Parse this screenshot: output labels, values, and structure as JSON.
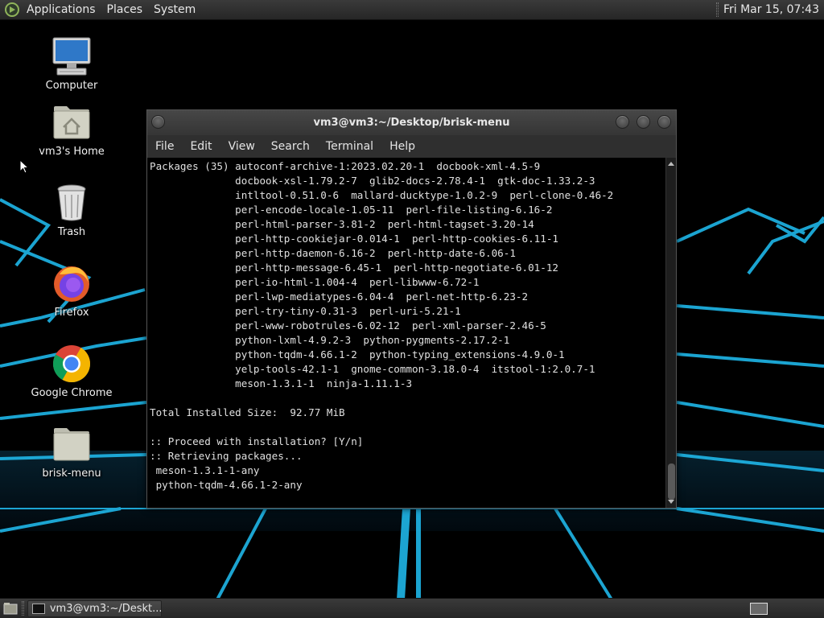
{
  "top_panel": {
    "menus": [
      "Applications",
      "Places",
      "System"
    ],
    "clock": "Fri Mar 15, 07:43"
  },
  "desktop_icons": [
    {
      "label": "Computer",
      "icon": "computer-icon"
    },
    {
      "label": "vm3's Home",
      "icon": "home-folder-icon"
    },
    {
      "label": "Trash",
      "icon": "trash-icon"
    },
    {
      "label": "Firefox",
      "icon": "firefox-icon"
    },
    {
      "label": "Google Chrome",
      "icon": "chrome-icon"
    },
    {
      "label": "brisk-menu",
      "icon": "folder-icon"
    }
  ],
  "terminal": {
    "title": "vm3@vm3:~/Desktop/brisk-menu",
    "menus": [
      "File",
      "Edit",
      "View",
      "Search",
      "Terminal",
      "Help"
    ],
    "lines": [
      "Packages (35) autoconf-archive-1:2023.02.20-1  docbook-xml-4.5-9",
      "              docbook-xsl-1.79.2-7  glib2-docs-2.78.4-1  gtk-doc-1.33.2-3",
      "              intltool-0.51.0-6  mallard-ducktype-1.0.2-9  perl-clone-0.46-2",
      "              perl-encode-locale-1.05-11  perl-file-listing-6.16-2",
      "              perl-html-parser-3.81-2  perl-html-tagset-3.20-14",
      "              perl-http-cookiejar-0.014-1  perl-http-cookies-6.11-1",
      "              perl-http-daemon-6.16-2  perl-http-date-6.06-1",
      "              perl-http-message-6.45-1  perl-http-negotiate-6.01-12",
      "              perl-io-html-1.004-4  perl-libwww-6.72-1",
      "              perl-lwp-mediatypes-6.04-4  perl-net-http-6.23-2",
      "              perl-try-tiny-0.31-3  perl-uri-5.21-1",
      "              perl-www-robotrules-6.02-12  perl-xml-parser-2.46-5",
      "              python-lxml-4.9.2-3  python-pygments-2.17.2-1",
      "              python-tqdm-4.66.1-2  python-typing_extensions-4.9.0-1",
      "              yelp-tools-42.1-1  gnome-common-3.18.0-4  itstool-1:2.0.7-1",
      "              meson-1.3.1-1  ninja-1.11.1-3",
      "",
      "Total Installed Size:  92.77 MiB",
      "",
      ":: Proceed with installation? [Y/n]",
      ":: Retrieving packages...",
      " meson-1.3.1-1-any",
      " python-tqdm-4.66.1-2-any"
    ]
  },
  "taskbar": {
    "task_label": "vm3@vm3:~/Deskt..."
  },
  "colors": {
    "panel": "#2f2f2f",
    "terminal_bg": "#000000",
    "wallpaper_accent": "#1fb6e8"
  }
}
